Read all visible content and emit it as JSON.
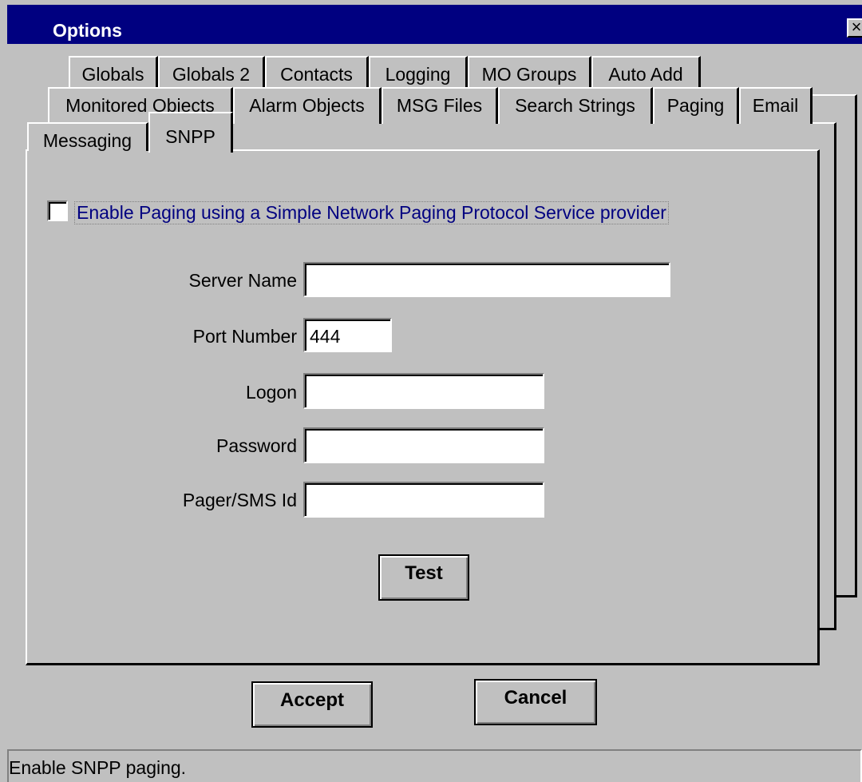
{
  "window": {
    "title": "Options",
    "close_glyph": "×"
  },
  "tabs": {
    "row1": [
      "Globals",
      "Globals 2",
      "Contacts",
      "Logging",
      "MO Groups",
      "Auto Add"
    ],
    "row2": [
      "Monitored Objects",
      "Alarm Objects",
      "MSG Files",
      "Search Strings",
      "Paging",
      "Email"
    ],
    "row3": [
      "Messaging",
      "SNPP"
    ],
    "active": "SNPP"
  },
  "snpp": {
    "enable_label": "Enable Paging using a Simple Network Paging Protocol Service provider",
    "enable_checked": false,
    "server_name_label": "Server Name",
    "server_name_value": "",
    "port_number_label": "Port Number",
    "port_number_value": "444",
    "logon_label": "Logon",
    "logon_value": "",
    "password_label": "Password",
    "password_value": "",
    "pager_id_label": "Pager/SMS Id",
    "pager_id_value": "",
    "test_label": "Test"
  },
  "buttons": {
    "accept": "Accept",
    "cancel": "Cancel"
  },
  "status": {
    "text": "Enable SNPP paging."
  }
}
